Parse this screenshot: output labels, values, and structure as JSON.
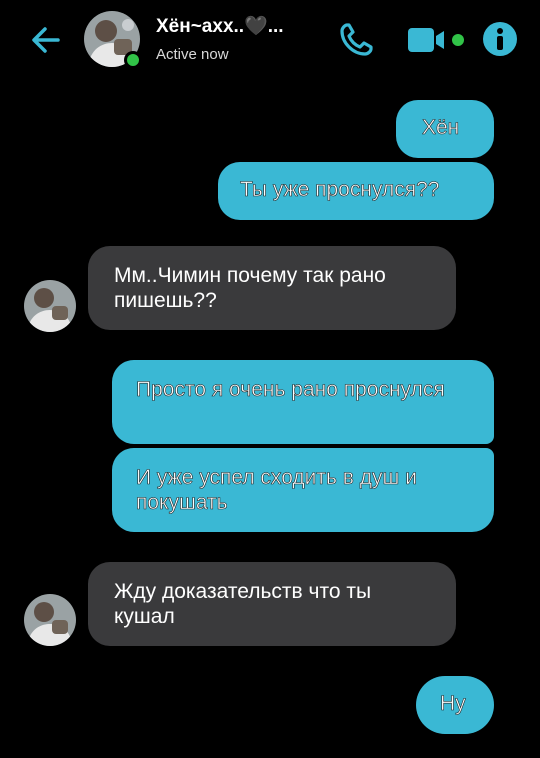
{
  "header": {
    "contact_name": "Хён~axx..🖤...",
    "status": "Active now",
    "accent_color": "#3ab8d4",
    "online_color": "#31c348"
  },
  "messages": [
    {
      "from": "me",
      "text": "Хён"
    },
    {
      "from": "me",
      "text": "Ты уже проснулся??"
    },
    {
      "from": "them",
      "text": "Мм..Чимин почему так рано пишешь??"
    },
    {
      "from": "me",
      "text": "Просто я очень рано проснулся"
    },
    {
      "from": "me",
      "text": "И уже успел сходить в душ и покушать"
    },
    {
      "from": "them",
      "text": "Жду доказательств что ты кушал"
    },
    {
      "from": "me",
      "text": "Ну"
    }
  ],
  "icons": {
    "back": "arrow-left-icon",
    "call": "phone-icon",
    "video": "video-camera-icon",
    "info": "info-icon"
  }
}
